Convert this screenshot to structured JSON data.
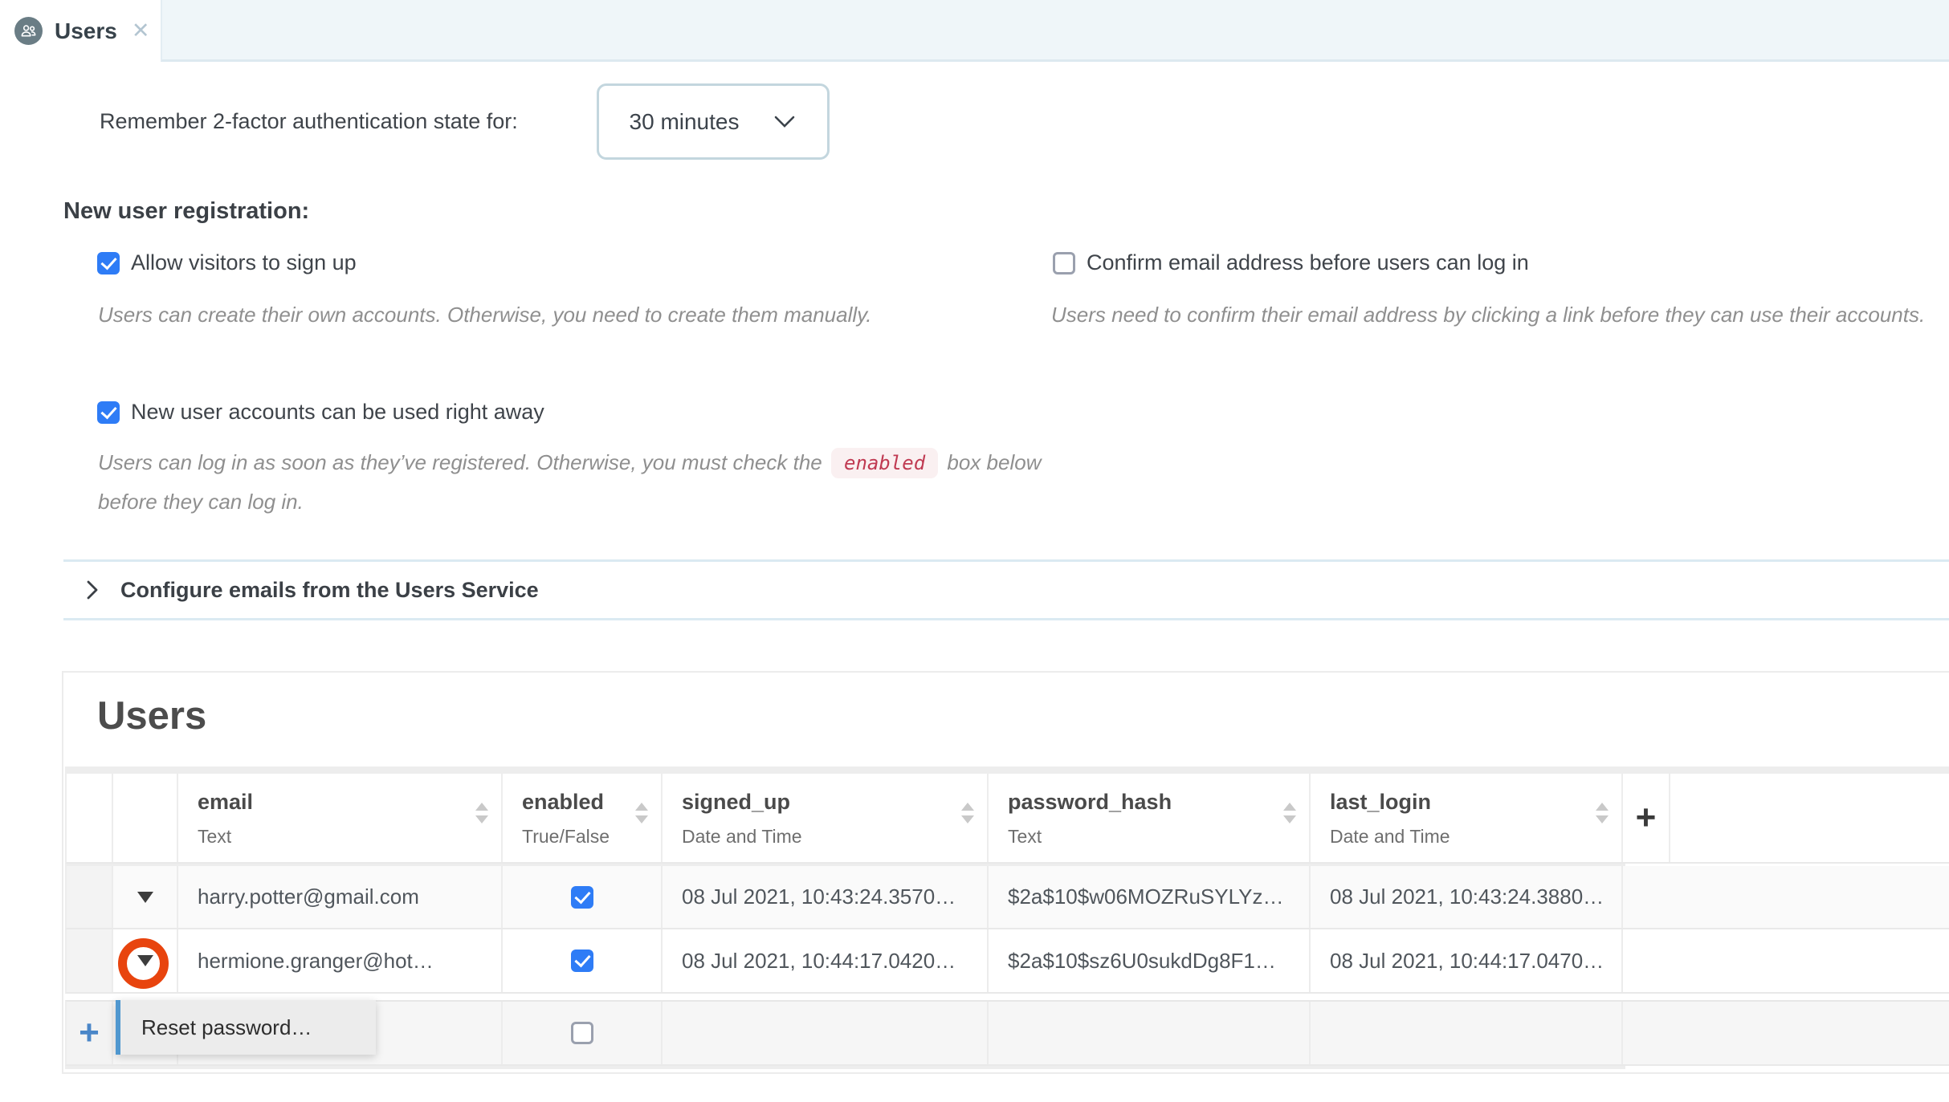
{
  "tab": {
    "label": "Users",
    "close_glyph": "✕"
  },
  "settings": {
    "remember_2fa_label": "Remember 2-factor authentication state for:",
    "remember_2fa_value": "30 minutes",
    "registration_heading": "New user registration:",
    "options": [
      {
        "label": "Allow visitors to sign up",
        "checked": true,
        "description": "Users can create their own accounts. Otherwise, you need to create them manually."
      },
      {
        "label": "Confirm email address before users can log in",
        "checked": false,
        "description": "Users need to confirm their email address by clicking a link before they can use their accounts."
      },
      {
        "label": "New user accounts can be used right away",
        "checked": true,
        "description_before": "Users can log in as soon as they’ve registered. Otherwise, you must check the",
        "description_code": "enabled",
        "description_after": "box below before they can log in."
      }
    ],
    "configure_emails_label": "Configure emails from the Users Service"
  },
  "table": {
    "title": "Users",
    "columns": [
      {
        "name": "email",
        "type": "Text"
      },
      {
        "name": "enabled",
        "type": "True/False"
      },
      {
        "name": "signed_up",
        "type": "Date and Time"
      },
      {
        "name": "password_hash",
        "type": "Text"
      },
      {
        "name": "last_login",
        "type": "Date and Time"
      }
    ],
    "add_column_glyph": "+",
    "add_row_glyph": "+",
    "rows": [
      {
        "email": "harry.potter@gmail.com",
        "enabled": true,
        "signed_up": "08 Jul 2021, 10:43:24.3570…",
        "password_hash": "$2a$10$w06MOZRuSYLYz…",
        "last_login": "08 Jul 2021, 10:43:24.3880…"
      },
      {
        "email": "hermione.granger@hot…",
        "enabled": true,
        "signed_up": "08 Jul 2021, 10:44:17.0420…",
        "password_hash": "$2a$10$sz6U0sukdDg8F1…",
        "last_login": "08 Jul 2021, 10:44:17.0470…"
      }
    ],
    "new_row": {
      "enabled": false
    }
  },
  "context_menu": {
    "items": [
      {
        "label": "Reset password…"
      }
    ]
  },
  "colors": {
    "accent_checkbox": "#2e7cf6",
    "highlight_circle": "#e8440e",
    "menu_accent_bar": "#4f97cf",
    "code_chip_text": "#c03a52",
    "code_chip_bg": "#faf0f1",
    "tabbar_bg": "#eff6f9",
    "tab_icon_bg": "#6a7d85"
  }
}
